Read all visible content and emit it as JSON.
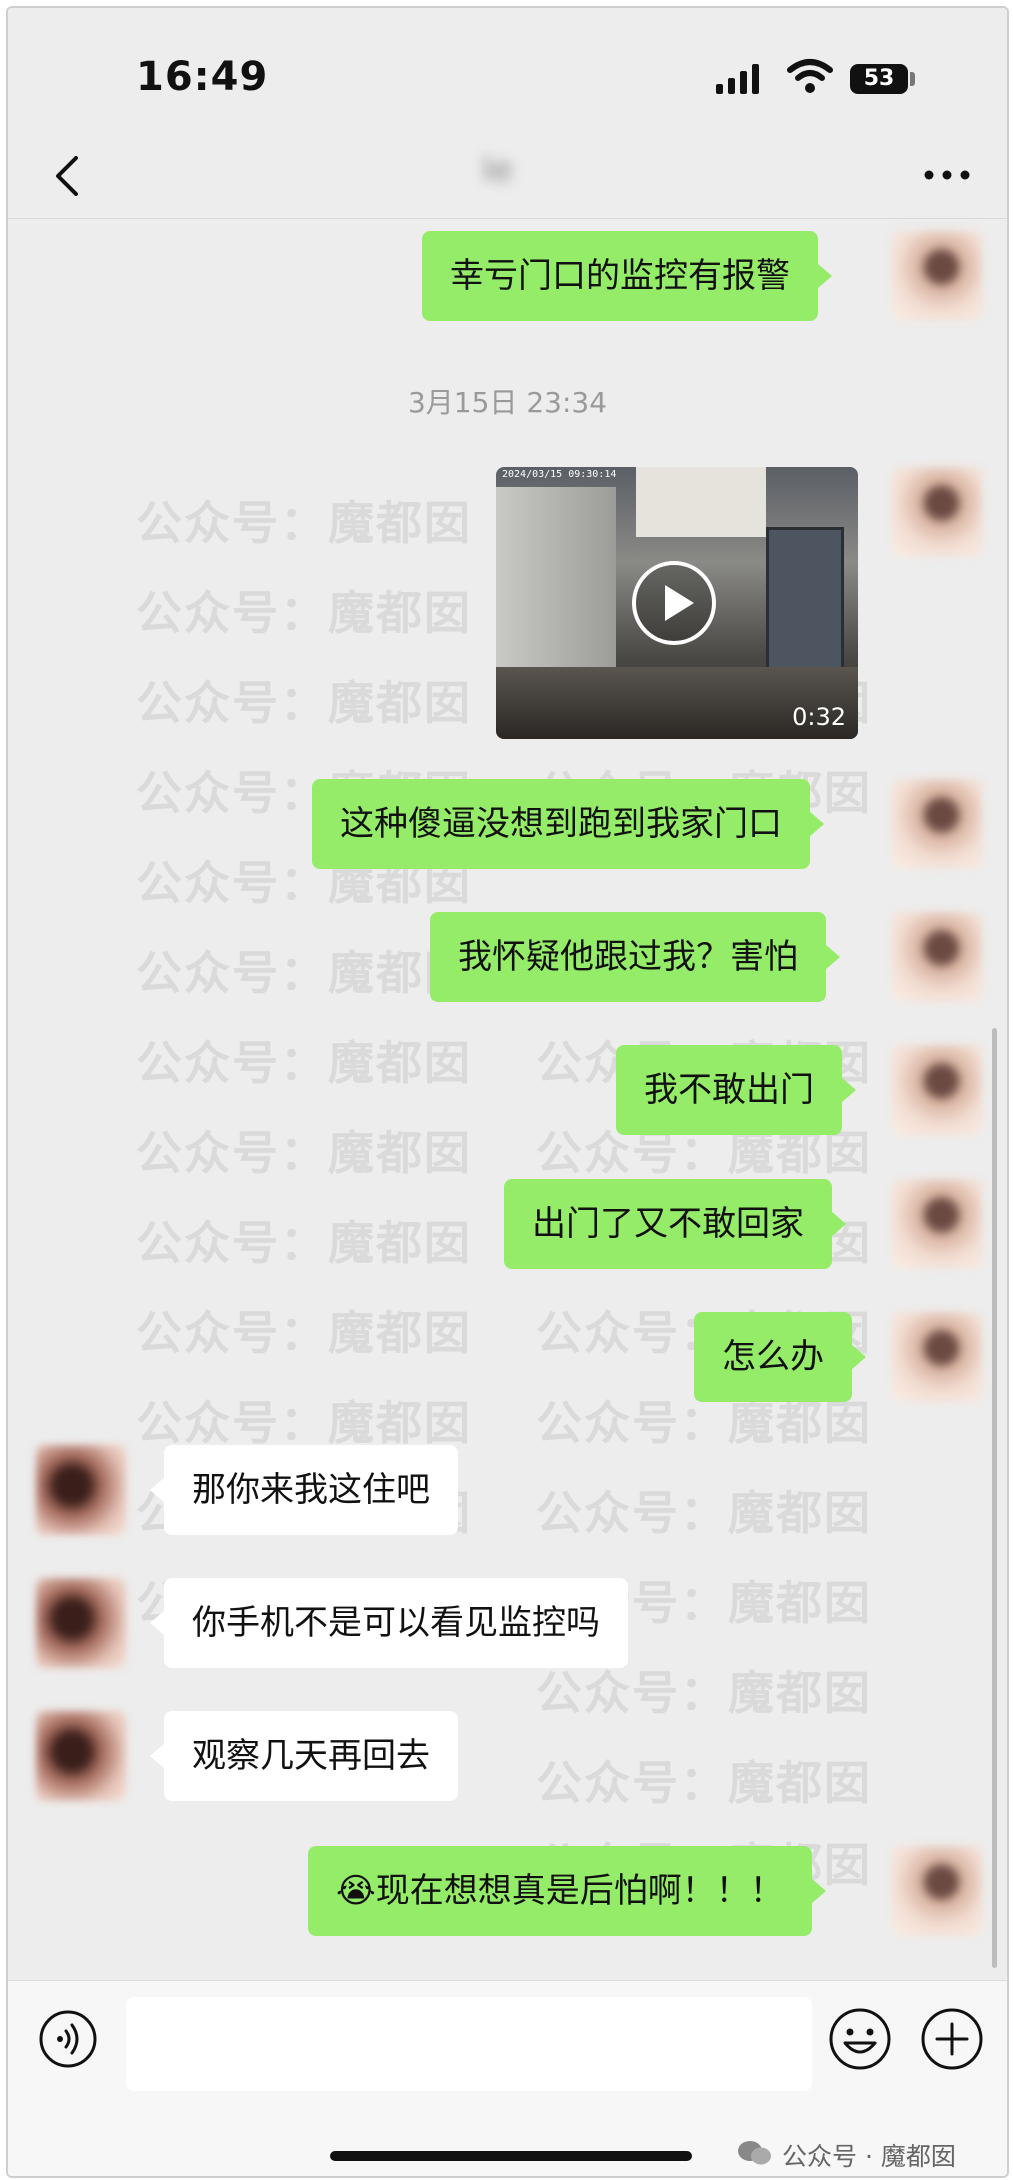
{
  "status_bar": {
    "time": "16:49",
    "battery": "53"
  },
  "nav": {
    "title": "Ie"
  },
  "messages": [
    {
      "side": "out",
      "text": "幸亏门口的监控有报警"
    },
    {
      "type": "timestamp",
      "text": "3月15日 23:34"
    },
    {
      "side": "out",
      "type": "video",
      "overlay_timestamp": "2024/03/15 09:30:14",
      "duration": "0:32"
    },
    {
      "side": "out",
      "text": "这种傻逼没想到跑到我家门口"
    },
    {
      "side": "out",
      "text": "我怀疑他跟过我？害怕"
    },
    {
      "side": "out",
      "text": "我不敢出门"
    },
    {
      "side": "out",
      "text": "出门了又不敢回家"
    },
    {
      "side": "out",
      "text": "怎么办"
    },
    {
      "side": "in",
      "text": "那你来我这住吧"
    },
    {
      "side": "in",
      "text": "你手机不是可以看见监控吗"
    },
    {
      "side": "in",
      "text": "观察几天再回去"
    },
    {
      "side": "out",
      "text": "😭现在想想真是后怕啊！！！"
    }
  ],
  "watermark": {
    "text": "公众号：魔都囡"
  },
  "input_bar": {
    "placeholder": ""
  },
  "footer": {
    "account_label": "公众号 · 魔都囡"
  },
  "colors": {
    "outgoing_bubble": "#95ec69",
    "incoming_bubble": "#ffffff",
    "background": "#ededed"
  }
}
